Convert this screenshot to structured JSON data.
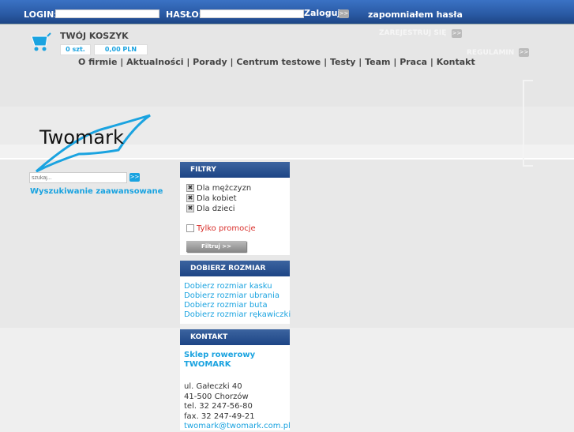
{
  "login": {
    "login_label": "LOGIN:",
    "password_label": "HASŁO:",
    "submit": "Zaloguj",
    "forgot": "zapomniałem hasła",
    "arrow": ">>"
  },
  "cart": {
    "title": "TWÓJ KOSZYK",
    "count": "0 szt.",
    "total": "0,00 PLN"
  },
  "links": {
    "register": "ZAREJESTRUJ SIĘ",
    "rules": "REGULAMIN"
  },
  "nav": [
    "O firmie",
    "Aktualności",
    "Porady",
    "Centrum testowe",
    "Testy",
    "Team",
    "Praca",
    "Kontakt"
  ],
  "logo": "Twomark",
  "search": {
    "placeholder": "szukaj...",
    "button": ">>",
    "advanced": "Wyszukiwanie zaawansowane"
  },
  "filters": {
    "title": "FILTRY",
    "options": [
      "Dla mężczyzn",
      "Dla kobiet",
      "Dla dzieci"
    ],
    "promo": "Tylko promocje",
    "button": "Filtruj >>"
  },
  "size": {
    "title": "DOBIERZ ROZMIAR",
    "links": [
      "Dobierz rozmiar kasku",
      "Dobierz rozmiar ubrania",
      "Dobierz rozmiar buta",
      "Dobierz rozmiar rękawiczki"
    ]
  },
  "contact": {
    "title": "KONTAKT",
    "name1": "Sklep rowerowy",
    "name2": "TWOMARK",
    "lines": [
      "ul. Gałeczki 40",
      "41-500 Chorzów",
      "tel. 32 247-56-80",
      "fax. 32 247-49-21"
    ],
    "email": "twomark@twomark.com.pl"
  },
  "colors": {
    "accent": "#1aa3e0",
    "header": "#1d4585",
    "promo": "#d9302c"
  }
}
